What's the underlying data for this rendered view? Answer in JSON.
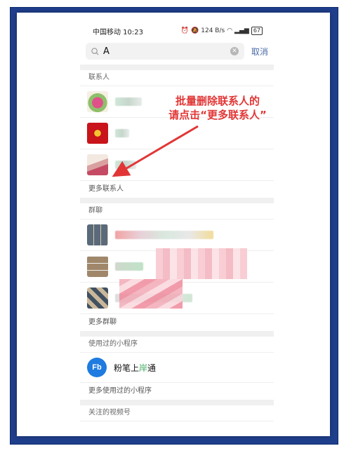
{
  "status": {
    "carrier_time": "中国移动 10:23",
    "signal": "124 B/s",
    "battery": "67"
  },
  "search": {
    "query": "A",
    "cancel": "取消"
  },
  "sections": {
    "contacts": {
      "label": "联系人",
      "more": "更多联系人"
    },
    "groups": {
      "label": "群聊",
      "more": "更多群聊"
    },
    "mini": {
      "label": "使用过的小程序",
      "item_a": "粉笔上",
      "item_hl": "岸",
      "item_b": "通",
      "logo": "Fb",
      "more": "更多使用过的小程序"
    },
    "channels": {
      "label": "关注的视频号"
    }
  },
  "annotation": {
    "line1": "批量删除联系人的",
    "line2": "请点击“更多联系人”"
  },
  "colors": {
    "frame": "#1f3f8c",
    "annotation": "#e23636",
    "cancel": "#4a6aa8"
  }
}
